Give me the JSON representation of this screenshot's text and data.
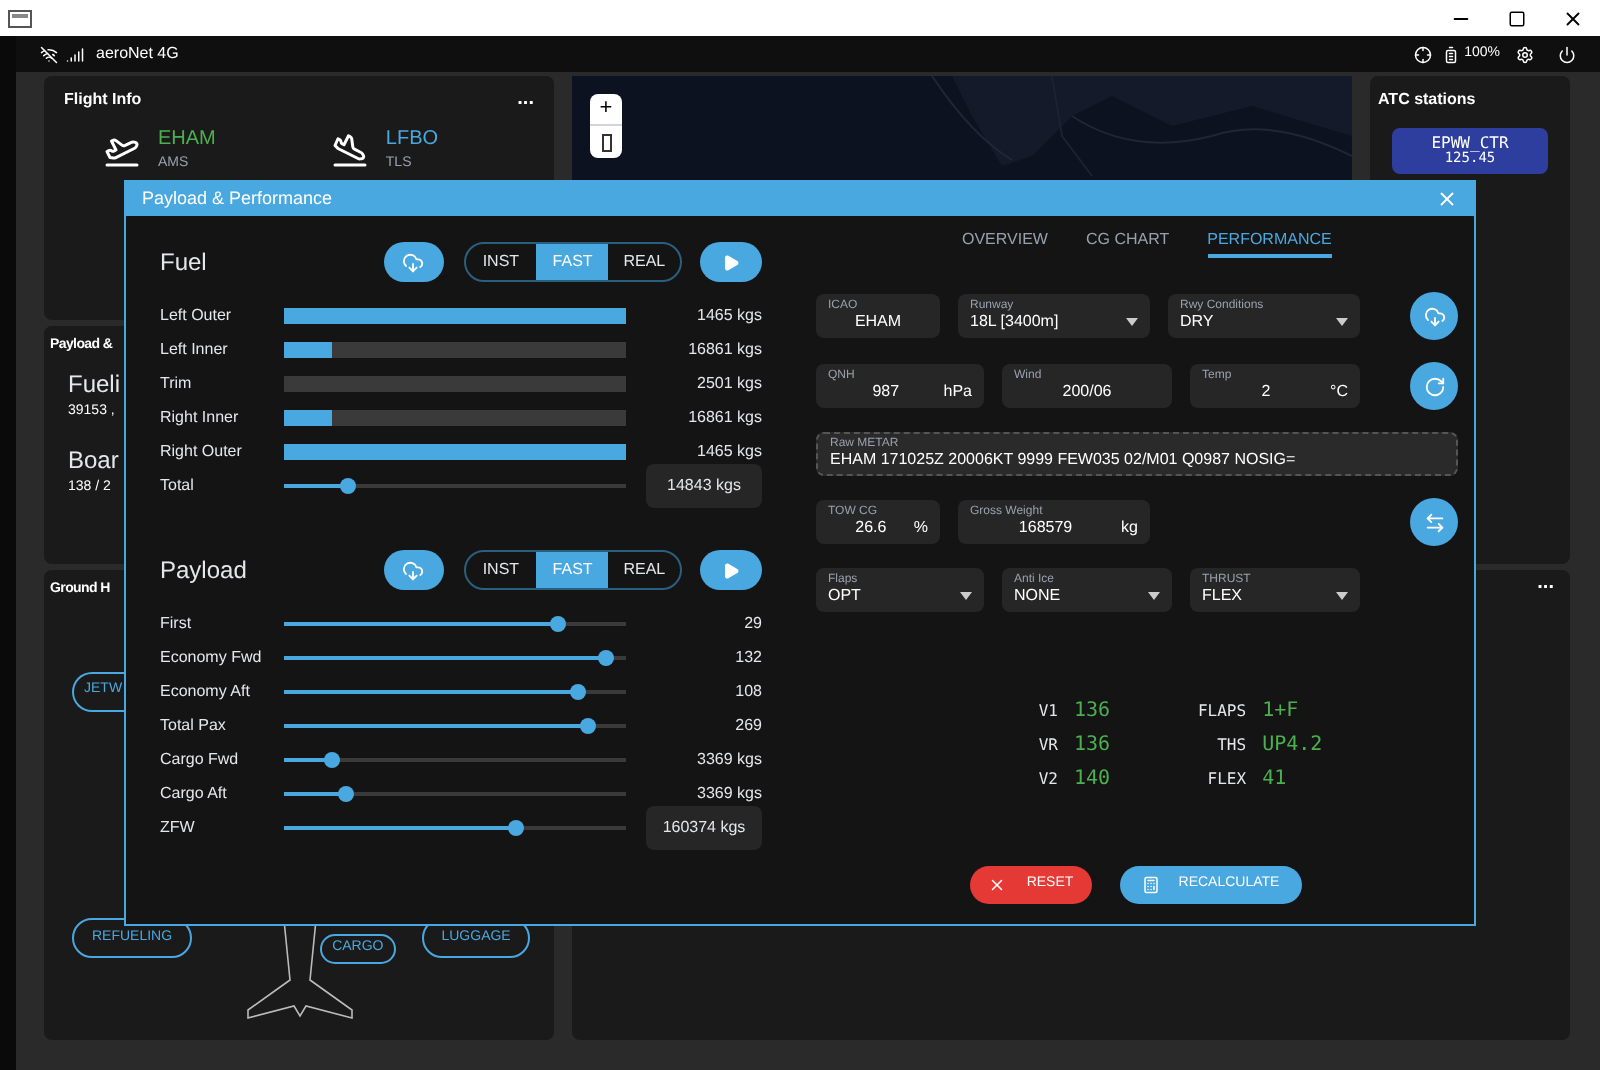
{
  "status_bar": {
    "network": "aeroNet 4G",
    "battery": "100%"
  },
  "flight_info": {
    "title": "Flight Info",
    "more": "...",
    "departure": {
      "code": "EHAM",
      "city": "AMS"
    },
    "arrival": {
      "code": "LFBO",
      "city": "TLS"
    }
  },
  "map": {
    "zoom_in": "+"
  },
  "atc": {
    "title": "ATC stations",
    "stations": [
      {
        "name": "EPWW_CTR",
        "frequency": "125.45"
      }
    ]
  },
  "payload_card": {
    "title": "Payload &",
    "fuel_label": "Fueli",
    "fuel_value": "39153 ,",
    "boarding_label": "Boar",
    "boarding_value": "138 / 2"
  },
  "ground": {
    "title": "Ground H",
    "buttons": [
      "JETW",
      "REFUELING",
      "CARGO",
      "LUGGAGE"
    ]
  },
  "side_panel": {
    "more": "..."
  },
  "modal": {
    "title": "Payload & Performance",
    "fuel": {
      "title": "Fuel",
      "modes": [
        {
          "label": "INST",
          "selected": false
        },
        {
          "label": "FAST",
          "selected": true
        },
        {
          "label": "REAL",
          "selected": false
        }
      ],
      "rows": [
        {
          "kind": "bar",
          "label": "Left Outer",
          "level": 1,
          "value": "1465 kgs"
        },
        {
          "kind": "bar",
          "label": "Left Inner",
          "level": 0.14,
          "value": "16861 kgs"
        },
        {
          "kind": "bar",
          "label": "Trim",
          "level": 0,
          "value": "2501 kgs"
        },
        {
          "kind": "bar",
          "label": "Right Inner",
          "level": 0.14,
          "value": "16861 kgs"
        },
        {
          "kind": "bar",
          "label": "Right Outer",
          "level": 1,
          "value": "1465 kgs"
        },
        {
          "kind": "total",
          "label": "Total",
          "level": 0.19,
          "value": "14843 kgs"
        }
      ]
    },
    "payload": {
      "title": "Payload",
      "modes": [
        {
          "label": "INST",
          "selected": false
        },
        {
          "label": "FAST",
          "selected": true
        },
        {
          "label": "REAL",
          "selected": false
        }
      ],
      "rows": [
        {
          "kind": "slider",
          "label": "First",
          "level": 0.8,
          "value": "29"
        },
        {
          "kind": "slider",
          "label": "Economy Fwd",
          "level": 0.94,
          "value": "132"
        },
        {
          "kind": "slider",
          "label": "Economy Aft",
          "level": 0.86,
          "value": "108"
        },
        {
          "kind": "slider",
          "label": "Total Pax",
          "level": 0.89,
          "value": "269"
        },
        {
          "kind": "slider",
          "label": "Cargo Fwd",
          "level": 0.14,
          "value": "3369 kgs"
        },
        {
          "kind": "slider",
          "label": "Cargo Aft",
          "level": 0.18,
          "value": "3369 kgs"
        },
        {
          "kind": "total",
          "label": "ZFW",
          "level": 0.68,
          "value": "160374 kgs"
        }
      ]
    },
    "tabs": [
      {
        "label": "OVERVIEW",
        "selected": false
      },
      {
        "label": "CG CHART",
        "selected": false
      },
      {
        "label": "PERFORMANCE",
        "selected": true
      }
    ],
    "field_rows": [
      [
        {
          "kind": "input",
          "label": "ICAO",
          "value": "EHAM"
        },
        {
          "kind": "select",
          "label": "Runway",
          "value": "18L [3400m]"
        },
        {
          "kind": "select",
          "label": "Rwy Conditions",
          "value": "DRY"
        }
      ],
      [
        {
          "kind": "input",
          "label": "QNH",
          "value": "987",
          "unit": "hPa"
        },
        {
          "kind": "input",
          "label": "Wind",
          "value": "200/06"
        },
        {
          "kind": "input",
          "label": "Temp",
          "value": "2",
          "unit": "°C"
        }
      ],
      [
        {
          "kind": "metar",
          "label": "Raw METAR",
          "value": "EHAM 171025Z 20006KT 9999 FEW035 02/M01 Q0987 NOSIG="
        }
      ],
      [
        {
          "kind": "input",
          "label": "TOW CG",
          "value": "26.6",
          "unit": "%"
        },
        {
          "kind": "input",
          "label": "Gross Weight",
          "value": "168579",
          "unit": "kg"
        }
      ],
      [
        {
          "kind": "select",
          "label": "Flaps",
          "value": "OPT"
        },
        {
          "kind": "select",
          "label": "Anti Ice",
          "value": "NONE"
        },
        {
          "kind": "select",
          "label": "THRUST",
          "value": "FLEX"
        }
      ]
    ],
    "speeds": [
      {
        "label": "V1",
        "value": "136"
      },
      {
        "label": "VR",
        "value": "136"
      },
      {
        "label": "V2",
        "value": "140"
      }
    ],
    "config": [
      {
        "label": "FLAPS",
        "value": "1+F"
      },
      {
        "label": "THS",
        "value": "UP4.2"
      },
      {
        "label": "FLEX",
        "value": "41"
      }
    ],
    "reset": "RESET",
    "recalculate": "RECALCULATE"
  }
}
